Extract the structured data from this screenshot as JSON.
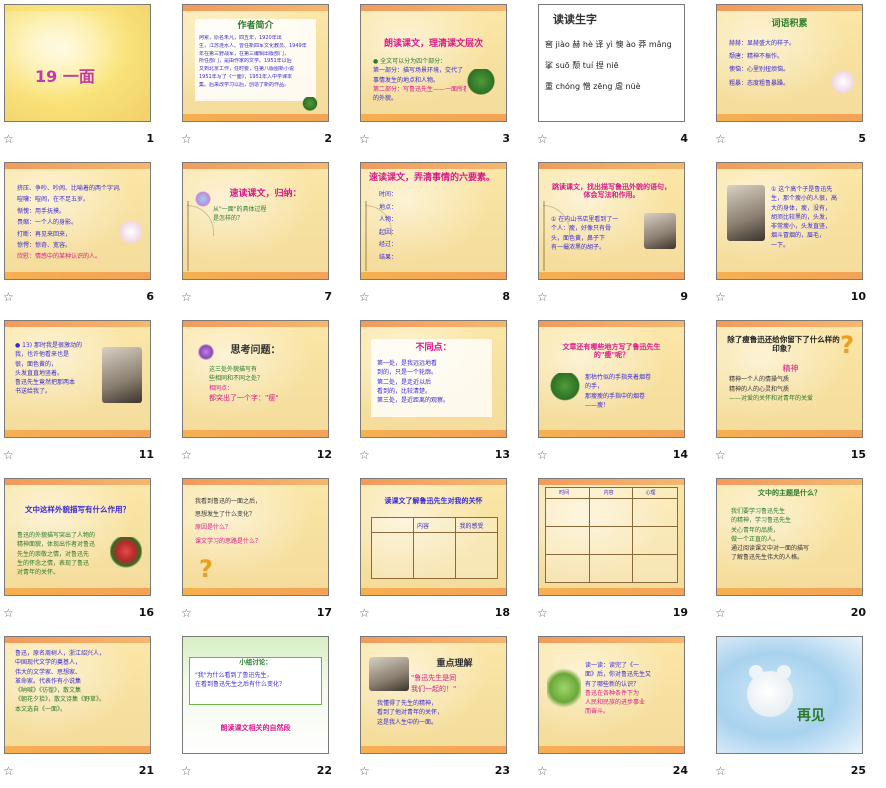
{
  "slides": [
    {
      "num": "1",
      "star": "☆",
      "title": "19 一面",
      "lines": []
    },
    {
      "num": "2",
      "star": "☆",
      "title": "作者简介",
      "lines": [
        "阿累，原名朱凡，四五年，1920年出",
        "生，江苏涟水人。曾任新四军文化教员、1949年",
        "年在第三野战军，在第三编辑出版部门，",
        "所任部门，是由作家的文学。1951年以后",
        "又到北京工作，任时要，任第八版图新小说",
        "1951年写了《一面》，1951年入中学课本",
        "集。后来改学习以后，创造了新的作品。"
      ]
    },
    {
      "num": "3",
      "star": "☆",
      "title": "朗读课文，理清课文层次",
      "lines": [
        "● 全文可以分为四个部分：",
        "第一部分：描写场景环境，交代了",
        "事情发生的地点和人物。",
        "第二部分：写鲁迅先生——一面所看到",
        "的外貌。"
      ]
    },
    {
      "num": "4",
      "star": "☆",
      "title": "读读生字",
      "lines": [
        "窖 jiào 赫 hè 译 yì 懊 ào 莽 mǎng",
        "挲 suō 颓 tuí 捏 niē",
        "重 chóng 憎 zēng 虐 nüè"
      ]
    },
    {
      "num": "5",
      "star": "☆",
      "title": "词语积累",
      "lines": [
        "赫赫：显赫盛大的样子。",
        "颓唐：精神不振作。",
        "懊恼：心里别扭烦恼。",
        "粗暴：态度粗鲁暴躁。"
      ]
    },
    {
      "num": "6",
      "star": "☆",
      "title": "",
      "lines": [
        "挤压、争吵、吵闹、比喻着的两个字词。",
        "喧嚷：喧闹，在不足五岁。",
        "惭愧：用手抚摸。",
        "畏缩：一个人的身影。",
        "打断：再见来回来，",
        "惊愕：惊奇、宽容。",
        "欣慰：情感中的某种认识的人。"
      ]
    },
    {
      "num": "7",
      "star": "☆",
      "title": "速读课文，归纳：",
      "lines": [
        "从\"一面\"的具体过程",
        "是怎样的？"
      ]
    },
    {
      "num": "8",
      "star": "☆",
      "title": "速读课文，弄清事情的六要素。",
      "lines": [
        "时间：",
        "地点：",
        "人物：",
        "起因：",
        "经过：",
        "结果："
      ]
    },
    {
      "num": "9",
      "star": "☆",
      "title": "跳读课文，找出描写鲁迅外貌的语句，体会写法和作用。",
      "lines": [
        "① 在内山书店里看到了一",
        "个人：瘦，好像只有骨",
        "头，面色黄，鼻子下",
        "有一撮浓黑的胡子。"
      ]
    },
    {
      "num": "10",
      "star": "☆",
      "title": "",
      "lines": [
        "① 这个高个子是鲁迅先",
        "生，那个瘦小的人很，高",
        "大的身体，瘦，没有，",
        "胡须比较黑的，头发，",
        "非常瘦小，头发直竖，",
        "烟斗冒烟的，眉毛，",
        "一下。"
      ]
    },
    {
      "num": "11",
      "star": "☆",
      "title": "",
      "lines": [
        "● 13) 那时我是很激动的",
        "我，也许他看来也是",
        "很，面色黄的，",
        "头发直直地竖着。",
        "鲁迅先生竟然把那两本",
        "书送给我了。"
      ]
    },
    {
      "num": "12",
      "star": "☆",
      "title": "思考问题：",
      "lines": [
        "这三处外貌描写有",
        "些相同和不同之处？",
        "相同点：",
        "都突出了一个字：\"瘦\""
      ]
    },
    {
      "num": "13",
      "star": "☆",
      "title": "不同点：",
      "lines": [
        "第一处，是我远远地看",
        "到的，只是一个轮廓。",
        "第二处，是走近以后",
        "看到的，比较清楚。",
        "第三处，是近距离的观察。"
      ]
    },
    {
      "num": "14",
      "star": "☆",
      "title": "文章还有哪些地方写了鲁迅先生的\"瘦\"呢？",
      "lines": [
        "那枯竹似的手指夹着烟卷",
        "的手，",
        "那瘦瘦的手指中的烟卷",
        "——瘦！"
      ]
    },
    {
      "num": "15",
      "star": "☆",
      "title": "除了瘦鲁迅还给你留下了什么样的印象？",
      "lines": [
        "精神",
        "精神一个人的情操气质",
        "精神的人的心灵和气质",
        "——对爱的关怀和对青年的关爱"
      ]
    },
    {
      "num": "16",
      "star": "☆",
      "title": "文中这样外貌描写有什么作用？",
      "lines": [
        "鲁迅的外貌描写突出了人物的",
        "精神面貌，体现出作者对鲁迅",
        "先生的崇敬之情，对鲁迅先",
        "生的怀念之情，表现了鲁迅",
        "对青年的关怀。"
      ]
    },
    {
      "num": "17",
      "star": "☆",
      "title": "",
      "lines": [
        "我看到鲁迅的一面之后，",
        "思想发生了什么变化？",
        "原因是什么？",
        "课文学习的思路是什么？"
      ]
    },
    {
      "num": "18",
      "star": "☆",
      "title": "读课文了解鲁迅先生对我的关怀",
      "lines": [
        "内容",
        "心理",
        "我的感受"
      ]
    },
    {
      "num": "19",
      "star": "☆",
      "title": "",
      "lines": [
        "时间",
        "内容",
        "心理"
      ]
    },
    {
      "num": "20",
      "star": "☆",
      "title": "文中的主题是什么？",
      "lines": [
        "我们要学习鲁迅先生",
        "的精神，学习鲁迅先生",
        "关心青年的品质，",
        "做一个正直的人。",
        "通过阅读课文中对一面的描写",
        "了解鲁迅先生伟大的人格。"
      ]
    },
    {
      "num": "21",
      "star": "☆",
      "title": "",
      "lines": [
        "鲁迅，原名周树人，浙江绍兴人，",
        "中国现代文学的奠基人，",
        "伟大的文学家、思想家、",
        "革命家。代表作有小说集",
        "《呐喊》《彷徨》，散文集",
        "《朝花夕拾》，散文诗集《野草》。",
        "本文选自《一面》。"
      ]
    },
    {
      "num": "22",
      "star": "☆",
      "title": "小组讨论：",
      "lines": [
        "\"我\"为什么看到了鲁迅先生，",
        "在看到鲁迅先生之后有什么变化？",
        "朗读课文相关的自然段"
      ]
    },
    {
      "num": "23",
      "star": "☆",
      "title": "重点理解",
      "lines": [
        "\"鲁迅先生是同",
        "我们一起的！\"",
        "我懂得了先生的精神，",
        "看到了他对青年的关怀，",
        "这是我人生中的一面。"
      ]
    },
    {
      "num": "24",
      "star": "☆",
      "title": "",
      "lines": [
        "读一读：读完了《一",
        "面》后，你对鲁迅先生又",
        "有了哪些新的认识？",
        "鲁迅在各种条件下为",
        "人民和民族的进步事业",
        "而奋斗。"
      ]
    },
    {
      "num": "25",
      "star": "☆",
      "title": "再见",
      "lines": []
    }
  ]
}
